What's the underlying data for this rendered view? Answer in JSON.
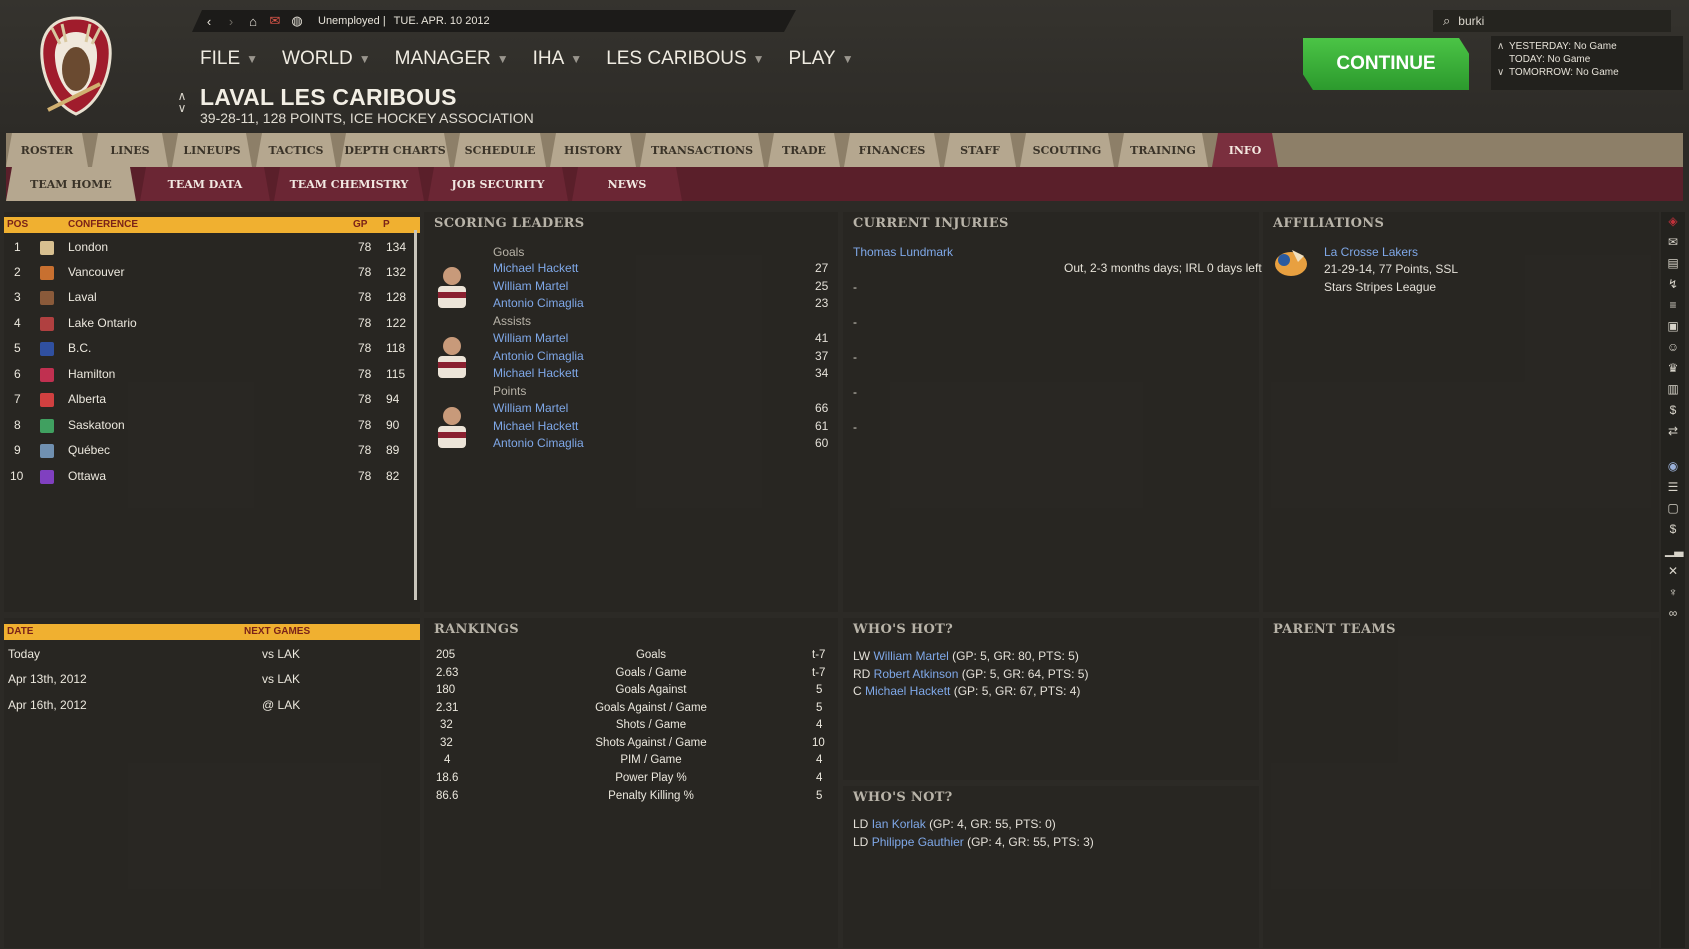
{
  "nav": {
    "status": "Unemployed |",
    "date": "TUE. APR. 10 2012"
  },
  "menu": [
    {
      "label": "FILE"
    },
    {
      "label": "WORLD"
    },
    {
      "label": "MANAGER"
    },
    {
      "label": "IHA"
    },
    {
      "label": "LES CARIBOUS"
    },
    {
      "label": "PLAY"
    }
  ],
  "team": {
    "name": "LAVAL LES CARIBOUS",
    "record": "39-28-11, 128 POINTS, ICE HOCKEY ASSOCIATION"
  },
  "search": {
    "value": "burki"
  },
  "continue_label": "CONTINUE",
  "days": {
    "yesterday": "YESTERDAY: No Game",
    "today": "TODAY: No Game",
    "tomorrow": "TOMORROW: No Game"
  },
  "tabs": [
    "ROSTER",
    "LINES",
    "LINEUPS",
    "TACTICS",
    "DEPTH CHARTS",
    "SCHEDULE",
    "HISTORY",
    "TRANSACTIONS",
    "TRADE",
    "FINANCES",
    "STAFF",
    "SCOUTING",
    "TRAINING",
    "INFO"
  ],
  "subtabs": [
    "TEAM HOME",
    "TEAM DATA",
    "TEAM CHEMISTRY",
    "JOB SECURITY",
    "NEWS"
  ],
  "standings": {
    "headers": {
      "pos": "POS",
      "conference": "CONFERENCE",
      "gp": "GP",
      "p": "P"
    },
    "rows": [
      {
        "pos": "1",
        "team": "London",
        "gp": "78",
        "p": "134",
        "color": "#d8c090"
      },
      {
        "pos": "2",
        "team": "Vancouver",
        "gp": "78",
        "p": "132",
        "color": "#c87030"
      },
      {
        "pos": "3",
        "team": "Laval",
        "gp": "78",
        "p": "128",
        "color": "#8a5a3a"
      },
      {
        "pos": "4",
        "team": "Lake Ontario",
        "gp": "78",
        "p": "122",
        "color": "#b04040"
      },
      {
        "pos": "5",
        "team": "B.C.",
        "gp": "78",
        "p": "118",
        "color": "#3050a0"
      },
      {
        "pos": "6",
        "team": "Hamilton",
        "gp": "78",
        "p": "115",
        "color": "#c03050"
      },
      {
        "pos": "7",
        "team": "Alberta",
        "gp": "78",
        "p": "94",
        "color": "#d04040"
      },
      {
        "pos": "8",
        "team": "Saskatoon",
        "gp": "78",
        "p": "90",
        "color": "#40a060"
      },
      {
        "pos": "9",
        "team": "Québec",
        "gp": "78",
        "p": "89",
        "color": "#7090b0"
      },
      {
        "pos": "10",
        "team": "Ottawa",
        "gp": "78",
        "p": "82",
        "color": "#8040c0"
      }
    ]
  },
  "next_games": {
    "headers": {
      "date": "DATE",
      "title": "NEXT GAMES"
    },
    "rows": [
      {
        "date": "Today",
        "opp": "vs LAK"
      },
      {
        "date": "Apr 13th, 2012",
        "opp": "vs LAK"
      },
      {
        "date": "Apr 16th, 2012",
        "opp": "@ LAK"
      }
    ]
  },
  "scoring": {
    "title": "SCORING LEADERS",
    "groups": [
      {
        "label": "Goals",
        "players": [
          {
            "name": "Michael Hackett",
            "val": "27"
          },
          {
            "name": "William Martel",
            "val": "25"
          },
          {
            "name": "Antonio Cimaglia",
            "val": "23"
          }
        ]
      },
      {
        "label": "Assists",
        "players": [
          {
            "name": "William Martel",
            "val": "41"
          },
          {
            "name": "Antonio Cimaglia",
            "val": "37"
          },
          {
            "name": "Michael Hackett",
            "val": "34"
          }
        ]
      },
      {
        "label": "Points",
        "players": [
          {
            "name": "William Martel",
            "val": "66"
          },
          {
            "name": "Michael Hackett",
            "val": "61"
          },
          {
            "name": "Antonio Cimaglia",
            "val": "60"
          }
        ]
      }
    ]
  },
  "injuries": {
    "title": "CURRENT INJURIES",
    "player": "Thomas Lundmark",
    "detail": "Out, 2-3 months days; IRL 0 days left",
    "dashes": [
      "-",
      "-",
      "-",
      "-",
      "-"
    ]
  },
  "affiliations": {
    "title": "AFFILIATIONS",
    "team": "La Crosse Lakers",
    "record": "21-29-14, 77 Points, SSL",
    "league": "Stars Stripes League"
  },
  "rankings": {
    "title": "RANKINGS",
    "rows": [
      {
        "val": "205",
        "stat": "Goals",
        "rank": "t-7"
      },
      {
        "val": "2.63",
        "stat": "Goals / Game",
        "rank": "t-7"
      },
      {
        "val": "180",
        "stat": "Goals Against",
        "rank": "5"
      },
      {
        "val": "2.31",
        "stat": "Goals Against / Game",
        "rank": "5"
      },
      {
        "val": "32",
        "stat": "Shots / Game",
        "rank": "4"
      },
      {
        "val": "32",
        "stat": "Shots Against / Game",
        "rank": "10"
      },
      {
        "val": "4",
        "stat": "PIM / Game",
        "rank": "4"
      },
      {
        "val": "18.6",
        "stat": "Power Play %",
        "rank": "4"
      },
      {
        "val": "86.6",
        "stat": "Penalty Killing %",
        "rank": "5"
      }
    ]
  },
  "hot": {
    "title": "WHO'S HOT?",
    "rows": [
      {
        "pos": "LW",
        "name": "William Martel",
        "stats": "(GP: 5, GR: 80, PTS: 5)"
      },
      {
        "pos": "RD",
        "name": "Robert Atkinson",
        "stats": "(GP: 5, GR: 64, PTS: 5)"
      },
      {
        "pos": "C",
        "name": "Michael Hackett",
        "stats": "(GP: 5, GR: 67, PTS: 4)"
      }
    ]
  },
  "not": {
    "title": "WHO'S NOT?",
    "rows": [
      {
        "pos": "LD",
        "name": "Ian Korlak",
        "stats": "(GP: 4, GR: 55, PTS: 0)"
      },
      {
        "pos": "LD",
        "name": "Philippe Gauthier",
        "stats": "(GP: 4, GR: 55, PTS: 3)"
      }
    ]
  },
  "parent": {
    "title": "PARENT TEAMS"
  },
  "colors": {
    "accent": "#f0b030",
    "tab": "#b5a78f",
    "tab_active": "#7a2f3e",
    "link": "#7fa8e8",
    "continue": "#3aae38"
  }
}
